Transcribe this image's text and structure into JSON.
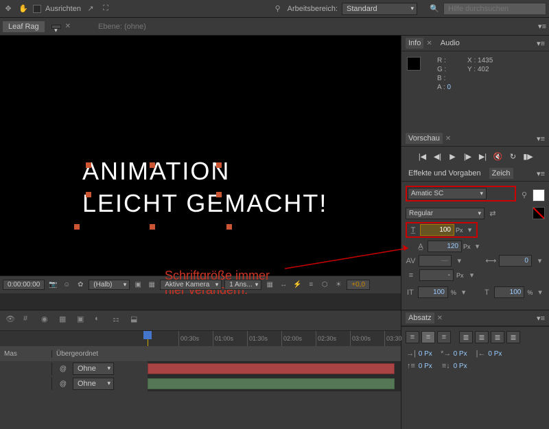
{
  "toolbar": {
    "align_label": "Ausrichten",
    "workspace_label": "Arbeitsbereich:",
    "workspace_value": "Standard",
    "search_placeholder": "Hilfe durchsuchen"
  },
  "secondary": {
    "comp_name": "Leaf Rag",
    "layer_label": "Ebene: (ohne)"
  },
  "canvas": {
    "text_line1": "ANIMATION",
    "text_line2": "LEICHT GEMACHT!",
    "annotation_line1": "Schriftgröße immer",
    "annotation_line2": "hier verändern."
  },
  "viewport_footer": {
    "timecode": "0:00:00:00",
    "res": "(Halb)",
    "camera": "Aktive Kamera",
    "views": "1 Ans...",
    "orbit_val": "+0,0"
  },
  "info": {
    "tab_info": "Info",
    "tab_audio": "Audio",
    "r": "R :",
    "g": "G :",
    "b": "B :",
    "a": "A :",
    "a_val": "0",
    "x": "X : 1435",
    "y": "Y :   402"
  },
  "preview": {
    "tab": "Vorschau"
  },
  "effects": {
    "tab": "Effekte und Vorgaben",
    "char_tab": "Zeich"
  },
  "character": {
    "font": "Amatic SC",
    "weight": "Regular",
    "size": "100",
    "leading": "120",
    "unit": "Px",
    "tracking": "-",
    "scale_h": "100",
    "scale_v": "100",
    "percent": "%",
    "baseline": "0"
  },
  "absatz": {
    "tab": "Absatz",
    "indent_left": "0 Px",
    "indent_right": "0 Px",
    "indent_first": "0 Px",
    "space_before": "0 Px",
    "space_after": "0 Px"
  },
  "timeline": {
    "col_mas": "Mas",
    "col_parent": "Übergeordnet",
    "layer_none": "Ohne",
    "ticks": [
      "00:30s",
      "01:00s",
      "01:30s",
      "02:00s",
      "02:30s",
      "03:00s",
      "03:30"
    ]
  }
}
